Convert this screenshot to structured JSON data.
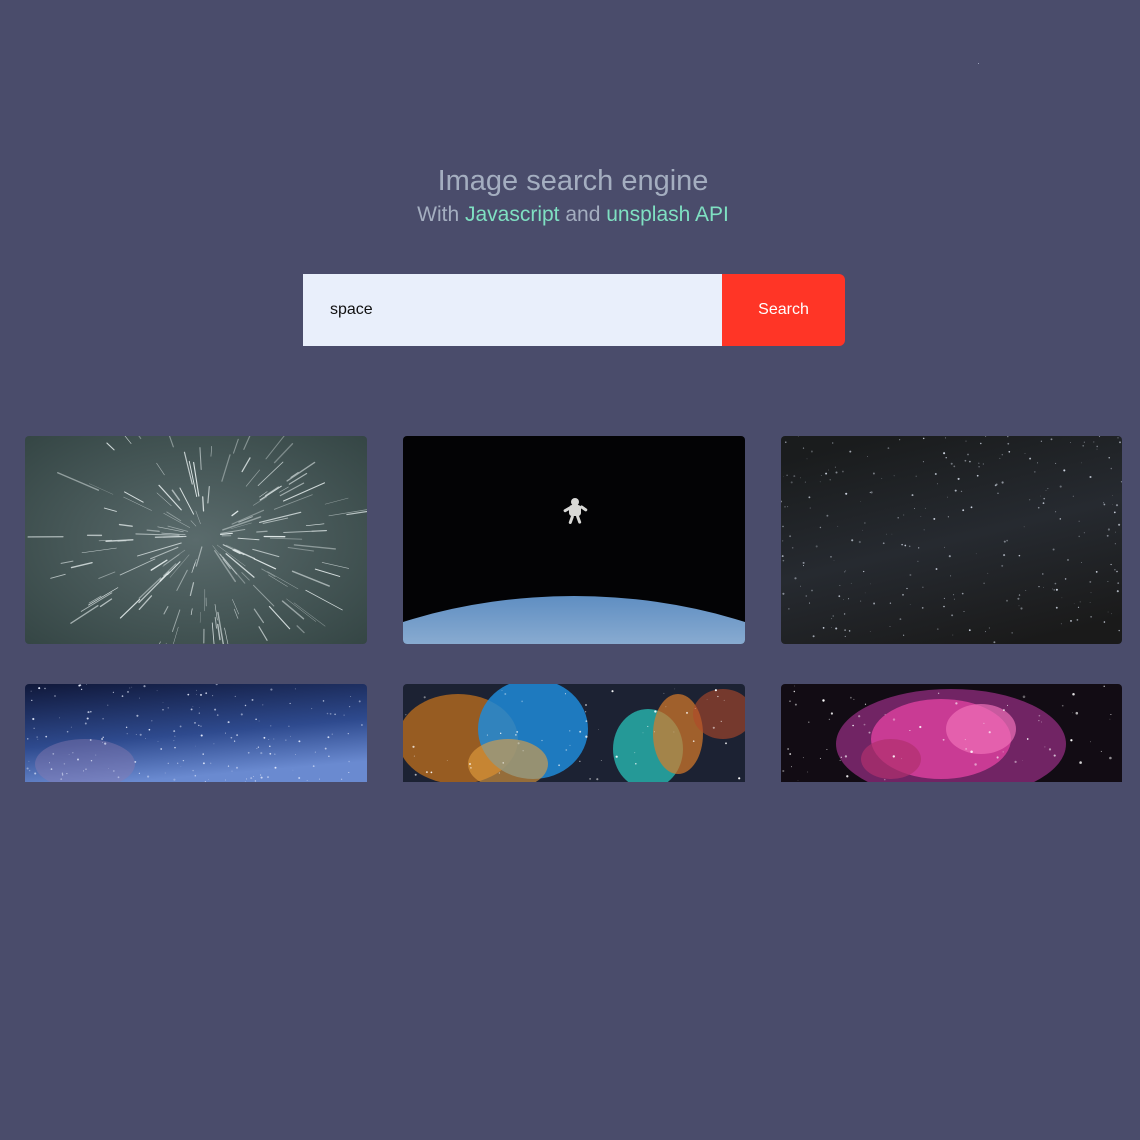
{
  "header": {
    "title": "Image search engine",
    "subtitle_prefix": "With",
    "subtitle_link1": "Javascript",
    "subtitle_mid": "and",
    "subtitle_link2": "unsplash API"
  },
  "search": {
    "value": "space",
    "button_label": "Search"
  },
  "colors": {
    "background": "#4a4c6b",
    "heading": "#a4aec0",
    "accent": "#7fe0c2",
    "input_bg": "#e9effb",
    "button_bg": "#ff3526"
  },
  "results": [
    {
      "icon": "star-streaks-image"
    },
    {
      "icon": "astronaut-over-earth-image"
    },
    {
      "icon": "milky-way-image"
    },
    {
      "icon": "blue-starfield-image"
    },
    {
      "icon": "colorful-nebula-image"
    },
    {
      "icon": "pink-nebula-image"
    }
  ]
}
